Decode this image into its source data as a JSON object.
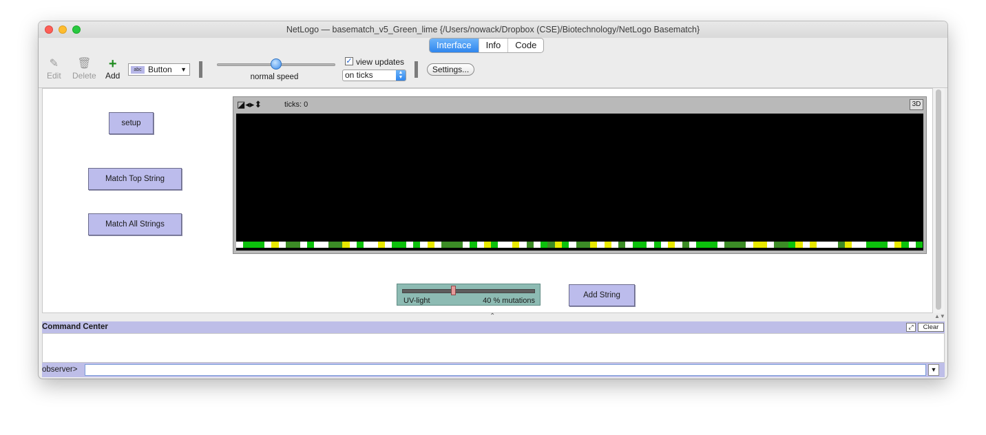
{
  "window": {
    "title": "NetLogo — basematch_v5_Green_lime {/Users/nowack/Dropbox (CSE)/Biotechnology/NetLogo Basematch}"
  },
  "tabs": [
    {
      "label": "Interface",
      "active": true
    },
    {
      "label": "Info",
      "active": false
    },
    {
      "label": "Code",
      "active": false
    }
  ],
  "toolbar": {
    "edit_label": "Edit",
    "delete_label": "Delete",
    "add_label": "Add",
    "widget_type_badge": "abc",
    "widget_type": "Button",
    "speed_label": "normal speed",
    "speed_value": 0.5,
    "view_updates_label": "view updates",
    "view_updates_checked": true,
    "update_mode": "on ticks",
    "settings_label": "Settings..."
  },
  "buttons": {
    "setup": "setup",
    "match_top": "Match Top String",
    "match_all": "Match All Strings",
    "add_string": "Add String"
  },
  "view": {
    "ticks_label": "ticks: 0",
    "btn_3d": "3D",
    "strip_colors": {
      "G": "#0cc00c",
      "D": "#3c8c26",
      "Y": "#e8e800",
      "W": "#ffffff"
    },
    "strip": "WWGGGGGGWWYYWWDDDDWWGGWWWWDDDDYYWWGGWWWWYYWWGGGGWWGGWWYYWWDDDDDDWWGGWWYYGGWWWWYYWWDDWWGGDDYYGGWWDDDDYYWWYYWWDDWWGGGGWWGGWWYYWWDDWWGGGGGGWWDDDDDDWWYYYYWWDDDDGGYYWWYYWWWWWWDDYYWWWWGGGGGGWWYYGGWWGG"
  },
  "slider": {
    "name": "UV-light",
    "value": 40,
    "value_text": "40 % mutations",
    "min": 0,
    "max": 100
  },
  "command_center": {
    "title": "Command Center",
    "clear_label": "Clear",
    "prompt": "observer>",
    "input_value": ""
  },
  "colors": {
    "button_bg": "#bcbcec",
    "slider_bg": "#8dbbb3",
    "command_center_bg": "#bebee8",
    "active_tab": "#2f86ee"
  }
}
